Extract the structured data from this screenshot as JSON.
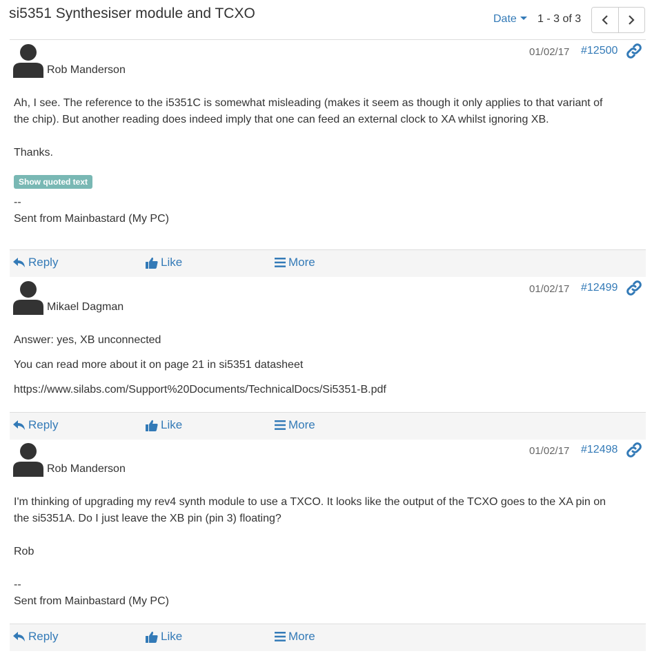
{
  "topic": {
    "title": "si5351 Synthesiser module and TCXO",
    "sort_label": "Date",
    "range_text": "1 - 3 of 3"
  },
  "actions": {
    "reply": "Reply",
    "like": "Like",
    "more": "More"
  },
  "messages": [
    {
      "author": "Rob Manderson",
      "date": "01/02/17",
      "number": "#12500",
      "line1": "Ah, I see.  The reference to the i5351C is somewhat misleading (makes it seem as though it only applies to that variant of",
      "line2": "the chip).  But another reading does indeed imply that one can feed an external clock to XA whilst ignoring XB.",
      "thanks": "Thanks.",
      "quote_button": "Show quoted text",
      "sig_dash": "--",
      "sig": "Sent from Mainbastard (My PC)"
    },
    {
      "author": "Mikael Dagman",
      "date": "01/02/17",
      "number": "#12499",
      "p1": "Answer: yes, XB unconnected",
      "p2": "You can read more about it on page 21 in si5351 datasheet",
      "p3": "https://www.silabs.com/Support%20Documents/TechnicalDocs/Si5351-B.pdf"
    },
    {
      "author": "Rob Manderson",
      "date": "01/02/17",
      "number": "#12498",
      "line1": "I'm thinking of upgrading my rev4 synth module to use a TXCO.  It looks like the output of the TCXO goes to the XA pin on",
      "line2": "the si5351A.  Do I just leave the XB pin (pin 3) floating?",
      "sign": "Rob",
      "sig_dash": "--",
      "sig": "Sent from Mainbastard (My PC)"
    }
  ]
}
